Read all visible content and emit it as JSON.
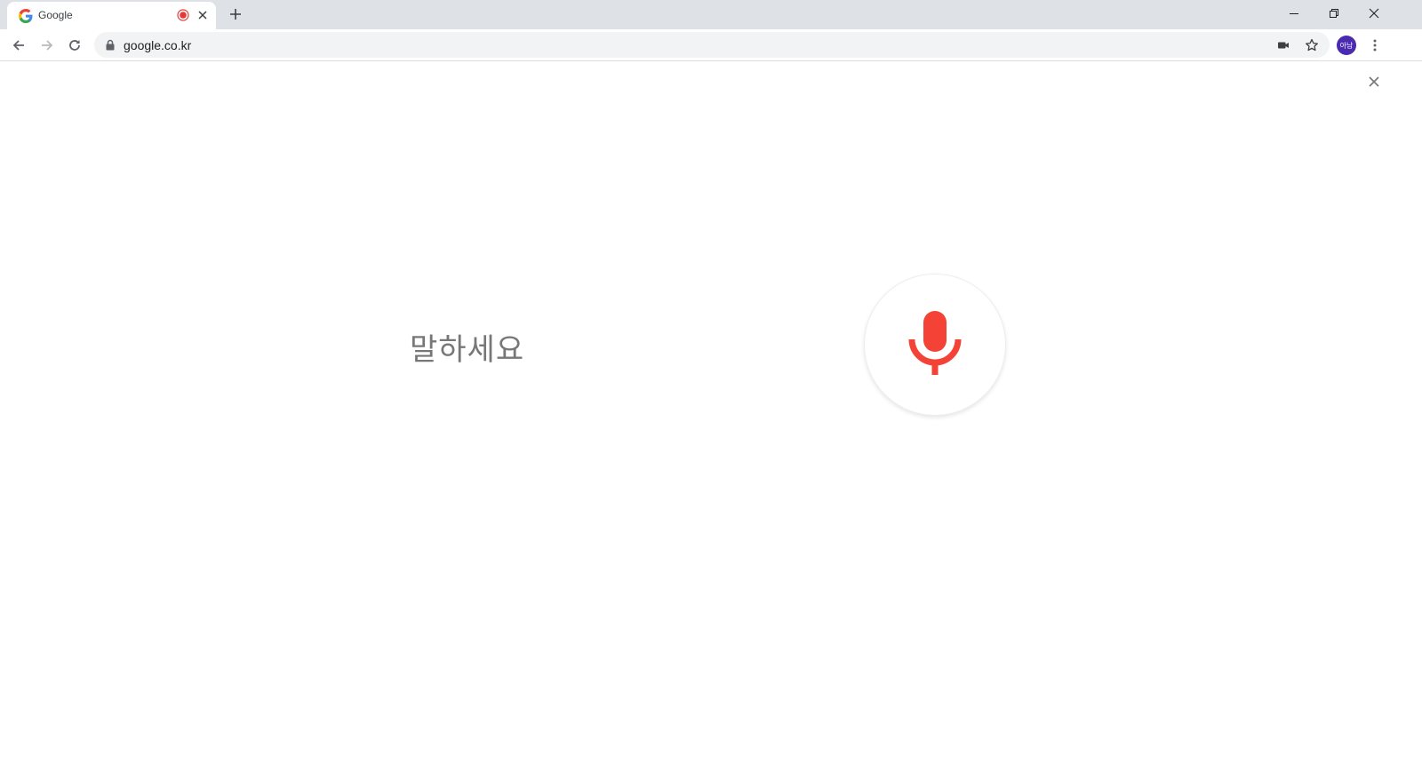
{
  "browser": {
    "tab": {
      "title": "Google",
      "favicon": "google-g-icon",
      "recording_indicator": "recording-dot-icon"
    },
    "window_controls": [
      "minimize-icon",
      "restore-icon",
      "close-icon"
    ],
    "address_bar": {
      "url": "google.co.kr",
      "security": "lock-icon"
    },
    "profile_initials": "아남"
  },
  "voice_search": {
    "prompt": "말하세요",
    "mic_color": "#f44336"
  },
  "colors": {
    "tabstrip": "#dee1e6",
    "omnibox": "#f1f3f4",
    "avatar": "#4a2ab0",
    "recording": "#e53935"
  }
}
